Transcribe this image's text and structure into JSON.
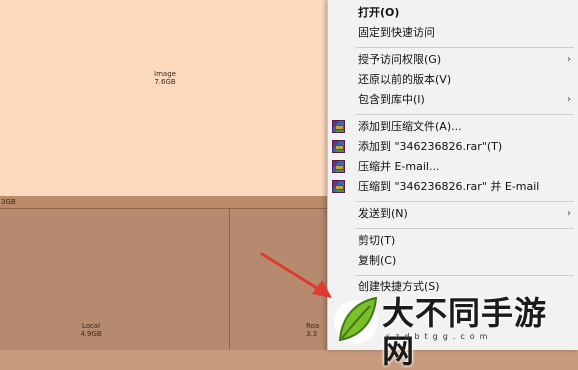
{
  "treemap": {
    "image_tile": {
      "name": "Image",
      "size": "7.6GB"
    },
    "strip_tile": {
      "size": "3GB"
    },
    "local_tile": {
      "name": "Local",
      "size": "4.9GB"
    },
    "roaming_tile": {
      "name": "Roa",
      "size": "3.3"
    }
  },
  "menu": {
    "open": "打开(O)",
    "pin_quick_access": "固定到快速访问",
    "grant_access": "授予访问权限(G)",
    "restore_versions": "还原以前的版本(V)",
    "include_library": "包含到库中(I)",
    "add_to_archive": "添加到压缩文件(A)...",
    "add_to_rar": "添加到 \"346236826.rar\"(T)",
    "compress_email": "压缩并 E-mail...",
    "compress_rar_email": "压缩到 \"346236826.rar\" 并 E-mail",
    "send_to": "发送到(N)",
    "cut": "剪切(T)",
    "copy": "复制(C)",
    "create_shortcut": "创建快捷方式(S)"
  },
  "colors": {
    "image_tile": "#fcd9bc",
    "folder_tile": "#b58a6f",
    "menu_bg": "#f2f2f2",
    "arrow": "#e03a30"
  },
  "watermark": {
    "text": "大不同手游网",
    "url": "szdbtgg.com"
  }
}
